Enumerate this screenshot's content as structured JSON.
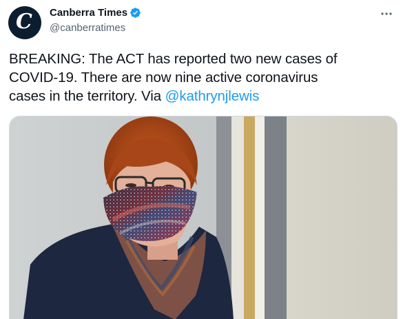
{
  "account": {
    "display_name": "Canberra Times",
    "handle": "@canberratimes",
    "avatar_letter": "C",
    "avatar_color": "#0b1d2e",
    "verified": true,
    "verified_icon": "verified-badge-icon"
  },
  "menu": {
    "icon": "more-horizontal-icon"
  },
  "tweet": {
    "text_line1": "BREAKING: The ACT has reported two new cases of",
    "text_line2": "COVID-19.  There are now nine active coronavirus",
    "text_line3_prefix": "cases in the territory. Via ",
    "mention": "@kathrynjlewis",
    "mention_color": "#1d9bf0"
  },
  "media": {
    "type": "photo",
    "subject": "woman wearing a patterned face mask and glasses"
  }
}
